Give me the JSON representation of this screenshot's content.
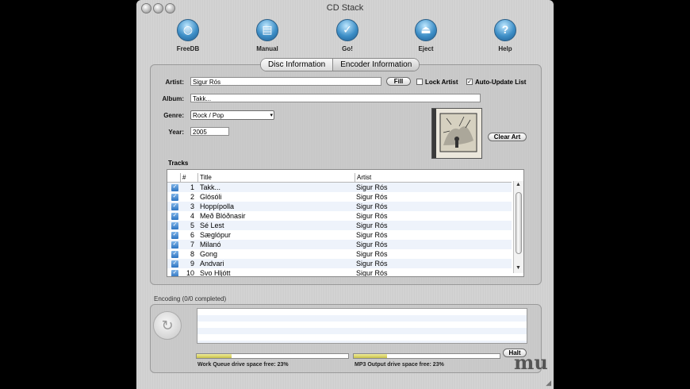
{
  "window": {
    "title": "CD Stack"
  },
  "toolbar": [
    {
      "label": "FreeDB",
      "icon": "globe-icon"
    },
    {
      "label": "Manual",
      "icon": "book-icon"
    },
    {
      "label": "Go!",
      "icon": "checkmark-icon"
    },
    {
      "label": "Eject",
      "icon": "eject-icon"
    },
    {
      "label": "Help",
      "icon": "question-icon"
    }
  ],
  "tabs": {
    "disc": "Disc Information",
    "encoder": "Encoder Information"
  },
  "disc": {
    "artist_label": "Artist:",
    "artist": "Sigur Rós",
    "fill_label": "Fill",
    "lock_artist_label": "Lock Artist",
    "lock_artist_checked": false,
    "auto_update_label": "Auto-Update List",
    "auto_update_checked": true,
    "album_label": "Album:",
    "album": "Takk...",
    "genre_label": "Genre:",
    "genre": "Rock / Pop",
    "year_label": "Year:",
    "year": "2005",
    "clear_art_label": "Clear Art"
  },
  "tracks": {
    "label": "Tracks",
    "columns": {
      "num": "#",
      "title": "Title",
      "artist": "Artist"
    },
    "rows": [
      {
        "num": "1",
        "title": "Takk...",
        "artist": "Sigur Rós"
      },
      {
        "num": "2",
        "title": "Glósóli",
        "artist": "Sigur Rós"
      },
      {
        "num": "3",
        "title": "Hoppípolla",
        "artist": "Sigur Rós"
      },
      {
        "num": "4",
        "title": "Með Blóðnasir",
        "artist": "Sigur Rós"
      },
      {
        "num": "5",
        "title": "Sé Lest",
        "artist": "Sigur Rós"
      },
      {
        "num": "6",
        "title": "Sæglópur",
        "artist": "Sigur Rós"
      },
      {
        "num": "7",
        "title": "Milanó",
        "artist": "Sigur Rós"
      },
      {
        "num": "8",
        "title": "Gong",
        "artist": "Sigur Rós"
      },
      {
        "num": "9",
        "title": "Andvari",
        "artist": "Sigur Rós"
      },
      {
        "num": "10",
        "title": "Svo Hljótt",
        "artist": "Sigur Rós"
      }
    ]
  },
  "encoding": {
    "label": "Encoding (0/0 completed)",
    "halt_label": "Halt",
    "work_queue_label": "Work Queue drive space free: 23%",
    "work_queue_free": 0.23,
    "mp3_output_label": "MP3 Output drive space free: 23%",
    "mp3_output_free": 0.23,
    "logo": "mu"
  }
}
